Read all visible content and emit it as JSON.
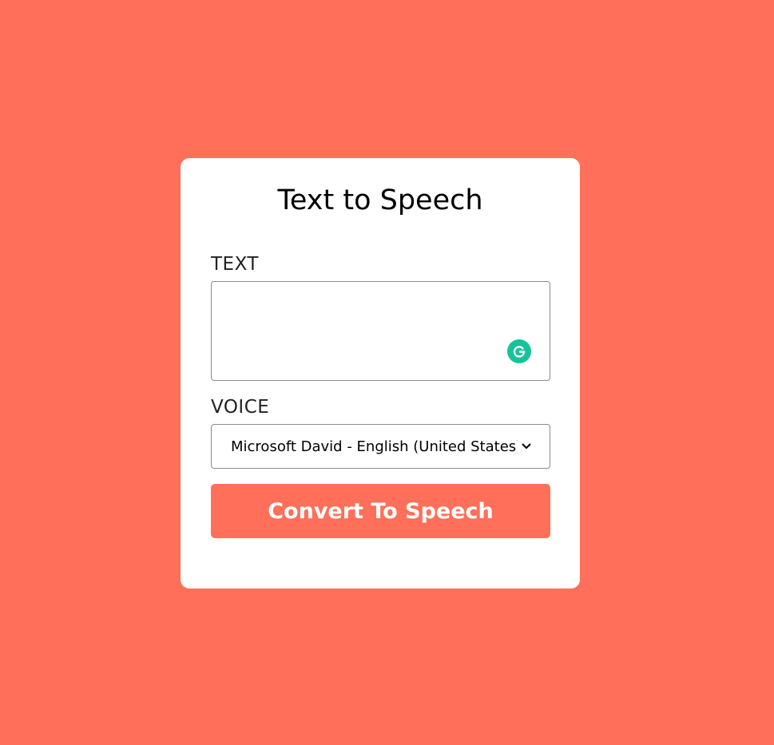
{
  "page": {
    "background_color": "#ff6f59"
  },
  "card": {
    "title": "Text to Speech"
  },
  "text_field": {
    "label": "TEXT",
    "value": "",
    "placeholder": "",
    "extension_icon": "grammarly-icon",
    "extension_color": "#15c39a"
  },
  "voice_field": {
    "label": "VOICE",
    "selected": "Microsoft David - English (United States)(en-US)",
    "icon": "chevron-down-icon"
  },
  "convert_button": {
    "label": "Convert To Speech",
    "color": "#ff6f59"
  }
}
